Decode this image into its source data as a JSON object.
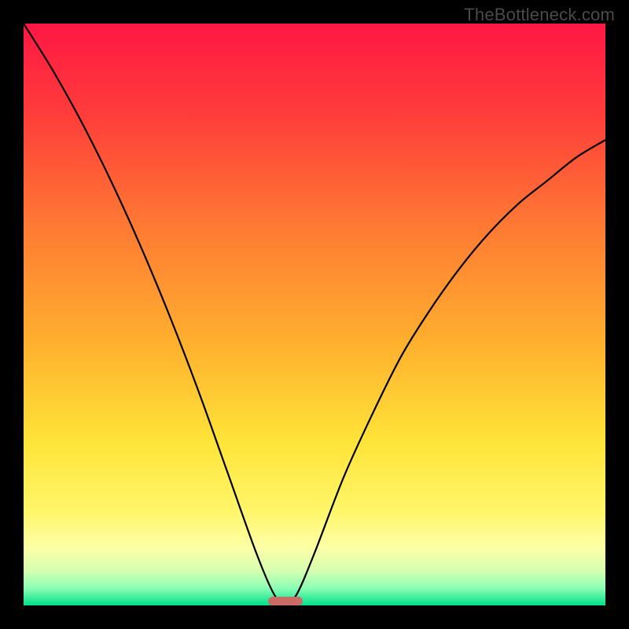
{
  "watermark": "TheBottleneck.com",
  "chart_data": {
    "type": "line",
    "title": "",
    "xlabel": "",
    "ylabel": "",
    "xlim": [
      0,
      100
    ],
    "ylim": [
      0,
      100
    ],
    "series": [
      {
        "name": "bottleneck-curve",
        "x": [
          0,
          5,
          10,
          15,
          20,
          25,
          30,
          35,
          40,
          43,
          45,
          47,
          50,
          55,
          60,
          65,
          70,
          75,
          80,
          85,
          90,
          95,
          100
        ],
        "values": [
          100,
          92,
          83,
          73,
          62,
          50,
          37,
          23,
          9,
          2,
          0,
          2,
          9,
          22,
          33,
          43,
          51,
          58,
          64,
          69,
          73,
          77,
          80
        ]
      }
    ],
    "optimal_x": 45,
    "gradient_stops": [
      {
        "pos": 0.0,
        "color": "#ff1744"
      },
      {
        "pos": 0.15,
        "color": "#ff3b3b"
      },
      {
        "pos": 0.35,
        "color": "#ff7a33"
      },
      {
        "pos": 0.55,
        "color": "#ffb02e"
      },
      {
        "pos": 0.72,
        "color": "#ffe438"
      },
      {
        "pos": 0.84,
        "color": "#fff66b"
      },
      {
        "pos": 0.9,
        "color": "#fdffa6"
      },
      {
        "pos": 0.94,
        "color": "#d6ffb0"
      },
      {
        "pos": 0.97,
        "color": "#8dffb4"
      },
      {
        "pos": 1.0,
        "color": "#00e08a"
      }
    ],
    "marker": {
      "x": 45,
      "y": 0,
      "w": 6,
      "h": 1.5,
      "color": "#cc6b66"
    }
  }
}
